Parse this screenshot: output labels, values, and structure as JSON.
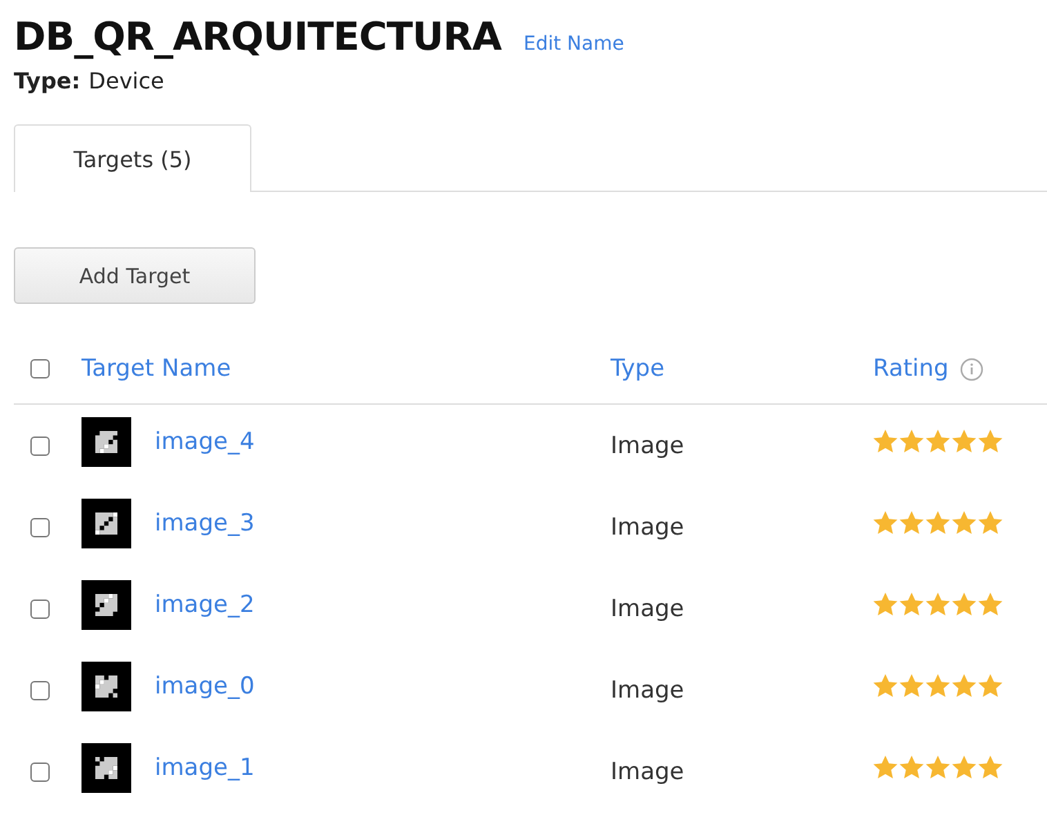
{
  "title": "DB_QR_ARQUITECTURA",
  "edit_link": "Edit Name",
  "type_label": "Type:",
  "type_value": "Device",
  "tabs": [
    {
      "label": "Targets (5)",
      "selected": true
    }
  ],
  "add_button": "Add Target",
  "table": {
    "select_all_checked": false,
    "columns": [
      "Target Name",
      "Type",
      "Rating"
    ],
    "rows": [
      {
        "name": "image_4",
        "type": "Image",
        "stars": 5,
        "checked": false
      },
      {
        "name": "image_3",
        "type": "Image",
        "stars": 5,
        "checked": false
      },
      {
        "name": "image_2",
        "type": "Image",
        "stars": 5,
        "checked": false
      },
      {
        "name": "image_0",
        "type": "Image",
        "stars": 5,
        "checked": false
      },
      {
        "name": "image_1",
        "type": "Image",
        "stars": 5,
        "checked": false
      }
    ]
  }
}
